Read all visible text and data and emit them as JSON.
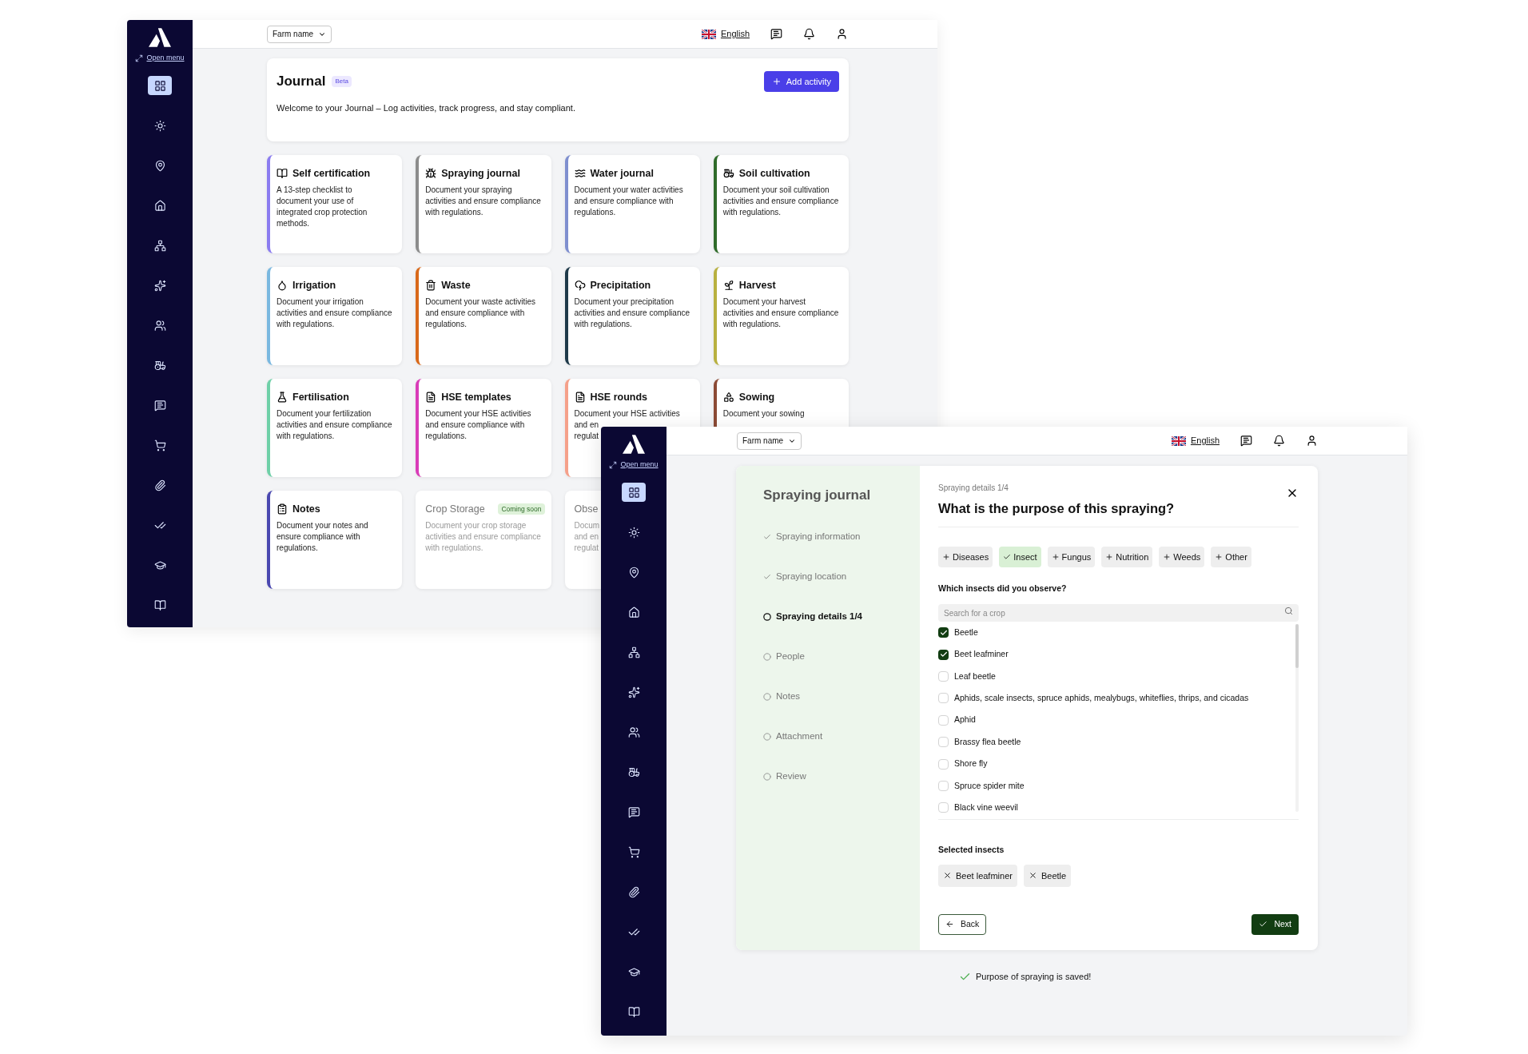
{
  "journal_window": {
    "sidebar": {
      "open_menu": "Open menu",
      "items": [
        {
          "selected": true
        },
        {
          "selected": false
        },
        {
          "selected": false
        },
        {
          "selected": false
        },
        {
          "selected": false
        },
        {
          "selected": false
        },
        {
          "selected": false
        },
        {
          "selected": false
        },
        {
          "selected": false
        },
        {
          "selected": false
        },
        {
          "selected": false
        },
        {
          "selected": false
        },
        {
          "selected": false
        },
        {
          "selected": false
        }
      ]
    },
    "topbar": {
      "farm_select": "Farm name",
      "language": "English"
    },
    "header": {
      "title": "Journal",
      "badge": "Beta",
      "add_button": "Add activity",
      "description": "Welcome to your Journal – Log activities, track progress, and stay compliant."
    },
    "cards": [
      {
        "title": "Self certification",
        "lines": [
          "A 13-step checklist to",
          "document your use of",
          "integrated crop protection",
          "methods."
        ],
        "color": "#8b7cf0",
        "disabled": false
      },
      {
        "title": "Spraying journal",
        "lines": [
          "Document your spraying",
          "activities and ensure compliance",
          "with regulations."
        ],
        "color": "#8c8c8c",
        "disabled": false
      },
      {
        "title": "Water journal",
        "lines": [
          "Document your water activities",
          "and ensure compliance with",
          "regulations."
        ],
        "color": "#7f8fcf",
        "disabled": false
      },
      {
        "title": "Soil cultivation",
        "lines": [
          "Document your soil cultivation",
          "activities and ensure compliance",
          "with regulations."
        ],
        "color": "#2f6b2a",
        "disabled": false
      },
      {
        "title": "Irrigation",
        "lines": [
          "Document your irrigation",
          "activities and ensure compliance",
          "with regulations."
        ],
        "color": "#7ab8e0",
        "disabled": false
      },
      {
        "title": "Waste",
        "lines": [
          "Document your waste activities",
          "and ensure compliance with",
          "regulations."
        ],
        "color": "#d9691a",
        "disabled": false
      },
      {
        "title": "Precipitation",
        "lines": [
          "Document your precipitation",
          "activities and ensure compliance",
          "with regulations."
        ],
        "color": "#1f3a4a",
        "disabled": false
      },
      {
        "title": "Harvest",
        "lines": [
          "Document your harvest",
          "activities and ensure compliance",
          "with regulations."
        ],
        "color": "#b8b040",
        "disabled": false
      },
      {
        "title": "Fertilisation",
        "lines": [
          "Document your fertilization",
          "activities and ensure compliance",
          "with regulations."
        ],
        "color": "#6fd0a8",
        "disabled": false
      },
      {
        "title": "HSE templates",
        "lines": [
          "Document your HSE activities",
          "and ensure compliance with",
          "regulations."
        ],
        "color": "#d93cb8",
        "disabled": false
      },
      {
        "title": "HSE rounds",
        "lines": [
          "Document your HSE activities",
          "and en",
          "regulat"
        ],
        "color": "#f5a08a",
        "disabled": false
      },
      {
        "title": "Sowing",
        "lines": [
          "Document your sowing"
        ],
        "color": "#8b4a35",
        "disabled": false
      },
      {
        "title": "Notes",
        "lines": [
          "Document your notes and",
          "ensure compliance with",
          "regulations."
        ],
        "color": "#4a48b0",
        "disabled": false
      },
      {
        "title": "Crop Storage",
        "badge": "Coming soon",
        "lines": [
          "Document your crop storage",
          "activities and ensure compliance",
          "with regulations."
        ],
        "disabled": true
      },
      {
        "title": "Obse",
        "lines": [
          "Docum",
          "and en",
          "regulat"
        ],
        "disabled": true
      }
    ]
  },
  "wizard_window": {
    "sidebar": {
      "open_menu": "Open menu",
      "items": [
        {
          "selected": true
        },
        {
          "selected": false
        },
        {
          "selected": false
        },
        {
          "selected": false
        },
        {
          "selected": false
        },
        {
          "selected": false
        },
        {
          "selected": false
        },
        {
          "selected": false
        },
        {
          "selected": false
        },
        {
          "selected": false
        },
        {
          "selected": false
        },
        {
          "selected": false
        },
        {
          "selected": false
        },
        {
          "selected": false
        }
      ]
    },
    "topbar": {
      "farm_select": "Farm name",
      "language": "English"
    },
    "wizard": {
      "title": "Spraying journal",
      "steps": [
        {
          "label": "Spraying information",
          "completed": true,
          "current": false
        },
        {
          "label": "Spraying location",
          "completed": true,
          "current": false
        },
        {
          "label": "Spraying details 1/4",
          "completed": false,
          "current": true
        },
        {
          "label": "People",
          "completed": false,
          "current": false
        },
        {
          "label": "Notes",
          "completed": false,
          "current": false
        },
        {
          "label": "Attachment",
          "completed": false,
          "current": false
        },
        {
          "label": "Review",
          "completed": false,
          "current": false
        }
      ],
      "step_caption": "Spraying details 1/4",
      "question": "What is the purpose of this spraying?",
      "purposes": [
        {
          "label": "Diseases",
          "selected": false
        },
        {
          "label": "Insect",
          "selected": true
        },
        {
          "label": "Fungus",
          "selected": false
        },
        {
          "label": "Nutrition",
          "selected": false
        },
        {
          "label": "Weeds",
          "selected": false
        },
        {
          "label": "Other",
          "selected": false
        }
      ],
      "insects_label": "Which insects did you observe?",
      "search": {
        "placeholder": "Search for a crop"
      },
      "insects": [
        {
          "label": "Beetle",
          "checked": true
        },
        {
          "label": "Beet leafminer",
          "checked": true
        },
        {
          "label": "Leaf beetle",
          "checked": false
        },
        {
          "label": "Aphids, scale insects, spruce aphids, mealybugs, whiteflies, thrips, and cicadas",
          "checked": false
        },
        {
          "label": "Aphid",
          "checked": false
        },
        {
          "label": "Brassy flea beetle",
          "checked": false
        },
        {
          "label": "Shore fly",
          "checked": false
        },
        {
          "label": "Spruce spider mite",
          "checked": false
        },
        {
          "label": "Black vine weevil",
          "checked": false
        }
      ],
      "selected_label": "Selected insects",
      "selected_insects": [
        "Beet leafminer",
        "Beetle"
      ],
      "back": "Back",
      "next": "Next"
    },
    "toast": "Purpose of spraying is saved!"
  }
}
